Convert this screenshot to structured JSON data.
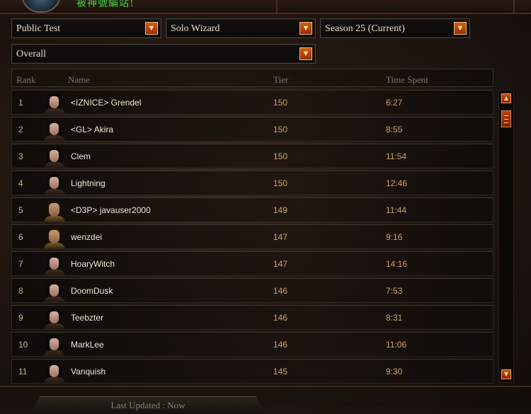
{
  "banner": {
    "text": "被神號編站!"
  },
  "filters": {
    "region": "Public Test",
    "category": "Solo Wizard",
    "season": "Season 25 (Current)",
    "scope": "Overall"
  },
  "columns": {
    "rank": "Rank",
    "name": "Name",
    "tier": "Tier",
    "time": "Time Spent"
  },
  "rows": [
    {
      "rank": "1",
      "name": "<IZNICE> Grendel",
      "tier": "150",
      "time": "6:27",
      "portrait": "female"
    },
    {
      "rank": "2",
      "name": "<GL> Akira",
      "tier": "150",
      "time": "8:55",
      "portrait": "female"
    },
    {
      "rank": "3",
      "name": "Clem",
      "tier": "150",
      "time": "11:54",
      "portrait": "female"
    },
    {
      "rank": "4",
      "name": "Lightning",
      "tier": "150",
      "time": "12:46",
      "portrait": "female"
    },
    {
      "rank": "5",
      "name": "<D3P> javauser2000",
      "tier": "149",
      "time": "11:44",
      "portrait": "male"
    },
    {
      "rank": "6",
      "name": "wenzdei",
      "tier": "147",
      "time": "9:16",
      "portrait": "male"
    },
    {
      "rank": "7",
      "name": "HoaryWitch",
      "tier": "147",
      "time": "14:16",
      "portrait": "female"
    },
    {
      "rank": "8",
      "name": "DoomDusk",
      "tier": "146",
      "time": "7:53",
      "portrait": "female"
    },
    {
      "rank": "9",
      "name": "Teebzter",
      "tier": "146",
      "time": "8:31",
      "portrait": "female"
    },
    {
      "rank": "10",
      "name": "MarkLee",
      "tier": "146",
      "time": "11:06",
      "portrait": "female"
    },
    {
      "rank": "11",
      "name": "Vanquish",
      "tier": "145",
      "time": "9:30",
      "portrait": "female"
    }
  ],
  "footer": {
    "last_updated": "Last Updated : Now"
  },
  "icons": {
    "dropdown": "chevron-down-icon",
    "scroll_up": "scroll-up-icon",
    "scroll_down": "scroll-down-icon"
  }
}
